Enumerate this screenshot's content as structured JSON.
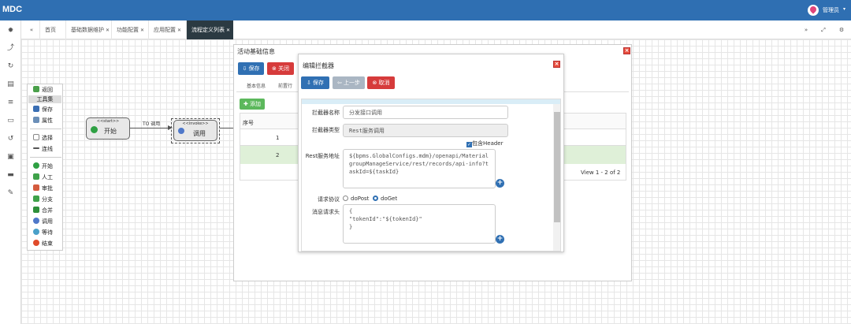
{
  "app": {
    "brand": "MDC",
    "user": "管理员"
  },
  "tabs": [
    {
      "label": "首页",
      "closable": false
    },
    {
      "label": "基础数据维护",
      "closable": true
    },
    {
      "label": "功能配置",
      "closable": true
    },
    {
      "label": "应用配置",
      "closable": true
    },
    {
      "label": "流程定义列表",
      "closable": true,
      "active": true
    }
  ],
  "toolbox": {
    "back": "返回",
    "header": "工具集",
    "save": "保存",
    "props": "属性",
    "select": "选择",
    "connect": "连线",
    "nodes": [
      "开始",
      "人工",
      "审批",
      "分支",
      "合并",
      "调用",
      "等待",
      "结束"
    ]
  },
  "flow": {
    "start_stereo": "<<start>>",
    "start_label": "开始",
    "edge_label": "TO 调用",
    "invoke_stereo": "<<invoke>>",
    "invoke_label": "调用"
  },
  "activity": {
    "title": "活动基础信息",
    "save": "保存",
    "close": "关闭",
    "tab1": "基本信息",
    "tab2": "前置行",
    "add": "添加",
    "col_header": "序号",
    "rows": [
      "1",
      "2"
    ],
    "pager": "View 1 - 2 of 2"
  },
  "editor": {
    "title": "编辑拦截器",
    "save": "保存",
    "prev": "上一步",
    "cancel": "取消",
    "name_label": "拦截器名称",
    "name_value": "分发接口调用",
    "type_label": "拦截器类型",
    "type_value": "Rest服务调用",
    "header_cb": "包含Header",
    "header_checked": true,
    "url_label": "Rest服务地址",
    "url_value": "${bpms.GlobalConfigs.mdm}/openapi/MaterialgroupManageService/rest/records/api-info?taskId=${taskId}",
    "method_label": "请求协议",
    "method_post": "doPost",
    "method_get": "doGet",
    "method_selected": "doGet",
    "headers_label": "消息请求头",
    "headers_value": "{\n\"tokenId\":\"${tokenId}\"\n}"
  }
}
